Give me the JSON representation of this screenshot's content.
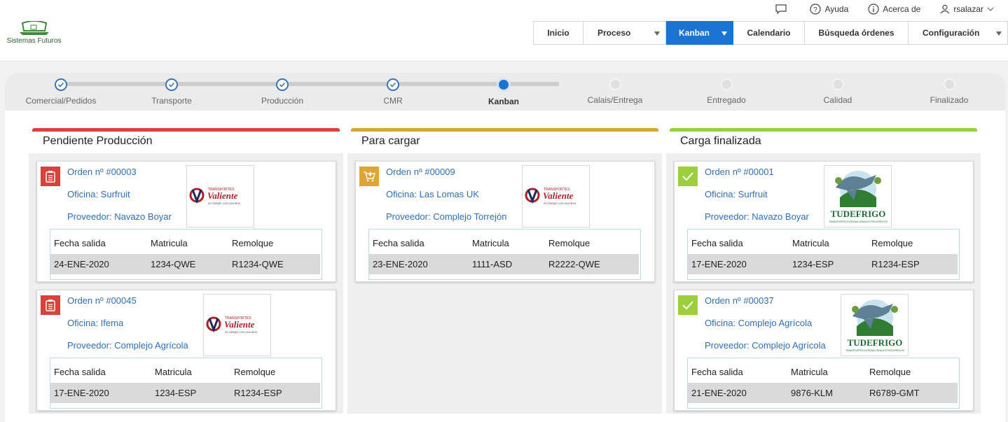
{
  "brand": {
    "name": "Sistemas Futuros"
  },
  "util": {
    "help": "Ayuda",
    "about": "Acerca de",
    "user": "rsalazar"
  },
  "nav": {
    "items": [
      "Inicio",
      "Proceso",
      "Kanban",
      "Calendario",
      "Búsqueda órdenes",
      "Configuración"
    ]
  },
  "steps": [
    "Comercial/Pedidos",
    "Transporte",
    "Producción",
    "CMR",
    "Kanban",
    "Calais/Entrega",
    "Entregado",
    "Calidad",
    "Finalizado"
  ],
  "columns": [
    {
      "title": "Pendiente Producción",
      "color": "#d9413a"
    },
    {
      "title": "Para cargar",
      "color": "#d6a832"
    },
    {
      "title": "Carga finalizada",
      "color": "#98cf3a"
    }
  ],
  "table_headers": {
    "date": "Fecha salida",
    "plate": "Matricula",
    "trailer": "Remolque"
  },
  "logos": {
    "valiente": {
      "small": "TRANSPORTES",
      "main": "Valiente",
      "tag": "en tiempo con nosotros"
    },
    "tudefrigo": {
      "main": "TUDEFRIGO",
      "tag": "TRANSPORTES INTERNACIONALES FRIGORÍFICOS"
    }
  },
  "cards": [
    {
      "order": "Orden nº #00003",
      "office": "Oficina: Surfruit",
      "provider": "Proveedor: Navazo Boyar",
      "date": "24-ENE-2020",
      "plate": "1234-QWE",
      "trailer": "R1234-QWE"
    },
    {
      "order": "Orden nº #00045",
      "office": "Oficina: Ifema",
      "provider": "Proveedor: Complejo Agrícola",
      "date": "17-ENE-2020",
      "plate": "1234-ESP",
      "trailer": "R1234-ESP"
    },
    {
      "order": "Orden nº #00009",
      "office": "Oficina: Las Lomas UK",
      "provider": "Proveedor: Complejo Torrejón",
      "date": "23-ENE-2020",
      "plate": "1111-ASD",
      "trailer": "R2222-QWE"
    },
    {
      "order": "Orden nº #00001",
      "office": "Oficina: Surfruit",
      "provider": "Proveedor: Navazo Boyar",
      "date": "17-ENE-2020",
      "plate": "1234-ESP",
      "trailer": "R1234-ESP"
    },
    {
      "order": "Orden nº #00037",
      "office": "Oficina: Complejo Agrícola",
      "provider": "Proveedor: Complejo Agrícola",
      "date": "21-ENE-2020",
      "plate": "9876-KLM",
      "trailer": "R6789-GMT"
    }
  ]
}
